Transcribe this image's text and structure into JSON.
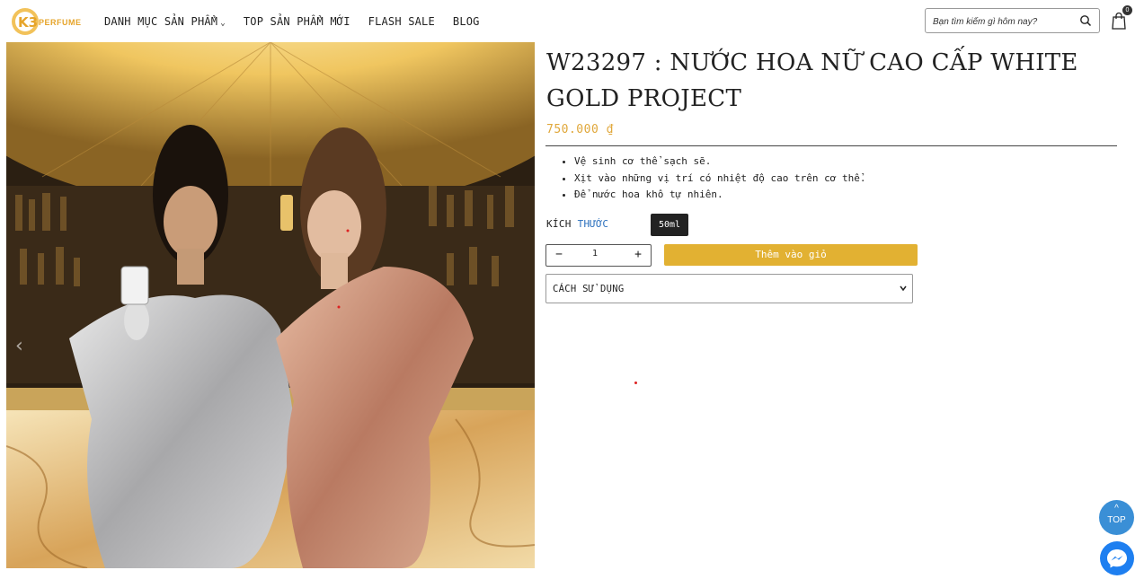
{
  "brand": {
    "logo_text": "PERFUME",
    "logo_mark": "K3"
  },
  "nav": {
    "items": [
      {
        "label": "DANH MỤC SẢN PHẨM",
        "has_dropdown": true
      },
      {
        "label": "TOP SẢN PHẨM MỚI",
        "has_dropdown": false
      },
      {
        "label": "FLASH SALE",
        "has_dropdown": false
      },
      {
        "label": "BLOG",
        "has_dropdown": false
      }
    ]
  },
  "search": {
    "placeholder": "Bạn tìm kiếm gì hôm nay?",
    "icon": "search-icon"
  },
  "cart": {
    "icon": "shopping-bag-icon",
    "count": "0"
  },
  "product": {
    "title": "W23297 : NƯỚC HOA NỮ CAO CẤP WHITE GOLD PROJECT",
    "price": "750.000 ₫",
    "bullets": [
      "Vệ sinh cơ thể sạch sẽ.",
      "Xịt vào những vị trí có nhiệt độ cao trên cơ thể.",
      "Để nước hoa khô tự nhiên."
    ],
    "size_label_main": "KÍCH ",
    "size_label_accent": "THƯỚC",
    "size_option": "50ml",
    "quantity": "1",
    "qty_minus": "−",
    "qty_plus": "+",
    "add_to_cart": "Thêm vào giỏ",
    "usage_label": "CÁCH SỬ DỤNG"
  },
  "floating": {
    "top_label": "TOP",
    "top_caret": "^"
  },
  "colors": {
    "accent_gold": "#e2b132",
    "price": "#e0a73a",
    "top_button": "#3a8fd6",
    "messenger": "#1e7ff0"
  }
}
